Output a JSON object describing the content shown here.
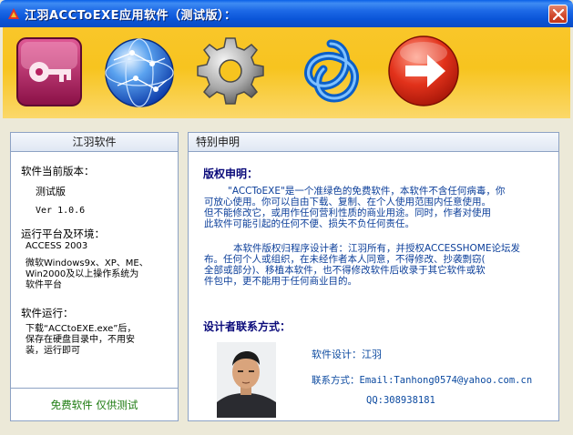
{
  "window": {
    "title": "江羽ACCToEXE应用软件（测试版）："
  },
  "toolbar": {
    "buttons": [
      {
        "name": "access-key-icon"
      },
      {
        "name": "globe-network-icon"
      },
      {
        "name": "gear-icon"
      },
      {
        "name": "trefoil-knot-icon"
      },
      {
        "name": "arrow-right-icon"
      }
    ]
  },
  "left_panel": {
    "header": "江羽软件",
    "version_heading": "软件当前版本：",
    "version_line1": "测试版",
    "version_line2": "Ver 1.0.6",
    "platform_heading": "运行平台及环境：",
    "platform_line1": "ACCESS 2003",
    "platform_line2": "微软Windows9x、XP、ME、",
    "platform_line3": "Win2000及以上操作系统为",
    "platform_line4": "软件平台",
    "run_heading": "软件运行：",
    "run_line1": "下载“ACCtoEXE.exe”后，",
    "run_line2": "保存在硬盘目录中，不用安",
    "run_line3": "装，运行即可",
    "footer": "免费软件 仅供测试"
  },
  "right_panel": {
    "header": "特别申明",
    "declaration_title": "版权申明：",
    "para1_line1": "\"ACCToEXE\"是一个准绿色的免费软件，本软件不含任何病毒，你",
    "para1_line2": "可放心使用。你可以自由下载、复制、在个人使用范围内任意使用。",
    "para1_line3": "但不能修改它，或用作任何营利性质的商业用途。同时，作者对使用",
    "para1_line4": "此软件可能引起的任何不便、损失不负任何责任。",
    "para2_line1": "本软件版权归程序设计者：江羽所有，并授权ACCESSHOME论坛发",
    "para2_line2": "布。任何个人或组织，在未经作者本人同意，不得修改、抄袭剽窃(",
    "para2_line3": "全部或部分)、移植本软件，也不得修改软件后收录于其它软件或软",
    "para2_line4": "件包中，更不能用于任何商业目的。",
    "designer_title": "设计者联系方式：",
    "designer": "软件设计：江羽",
    "contact_email": "联系方式：Email:Tanhong0574@yahoo.com.cn",
    "contact_qq": "QQ:308938181"
  },
  "colors": {
    "titlebar": "#0a55d8",
    "toolbar": "#f7c41f",
    "panel_border": "#8da2c4",
    "heading_text": "#0a0a7a",
    "body_text": "#0c3f9a",
    "footer_text": "#1d7b10"
  }
}
